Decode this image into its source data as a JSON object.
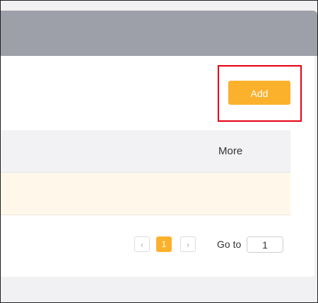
{
  "toolbar": {
    "add_label": "Add"
  },
  "table": {
    "columns": [
      "More"
    ]
  },
  "pagination": {
    "prev_icon": "chevron-left-icon",
    "next_icon": "chevron-right-icon",
    "current_page": "1",
    "goto_label": "Go to",
    "goto_value": "1"
  },
  "colors": {
    "accent": "#fbb12c",
    "header": "#9ea0a9",
    "highlight": "#e60012",
    "row_highlight": "#fff8ea"
  }
}
